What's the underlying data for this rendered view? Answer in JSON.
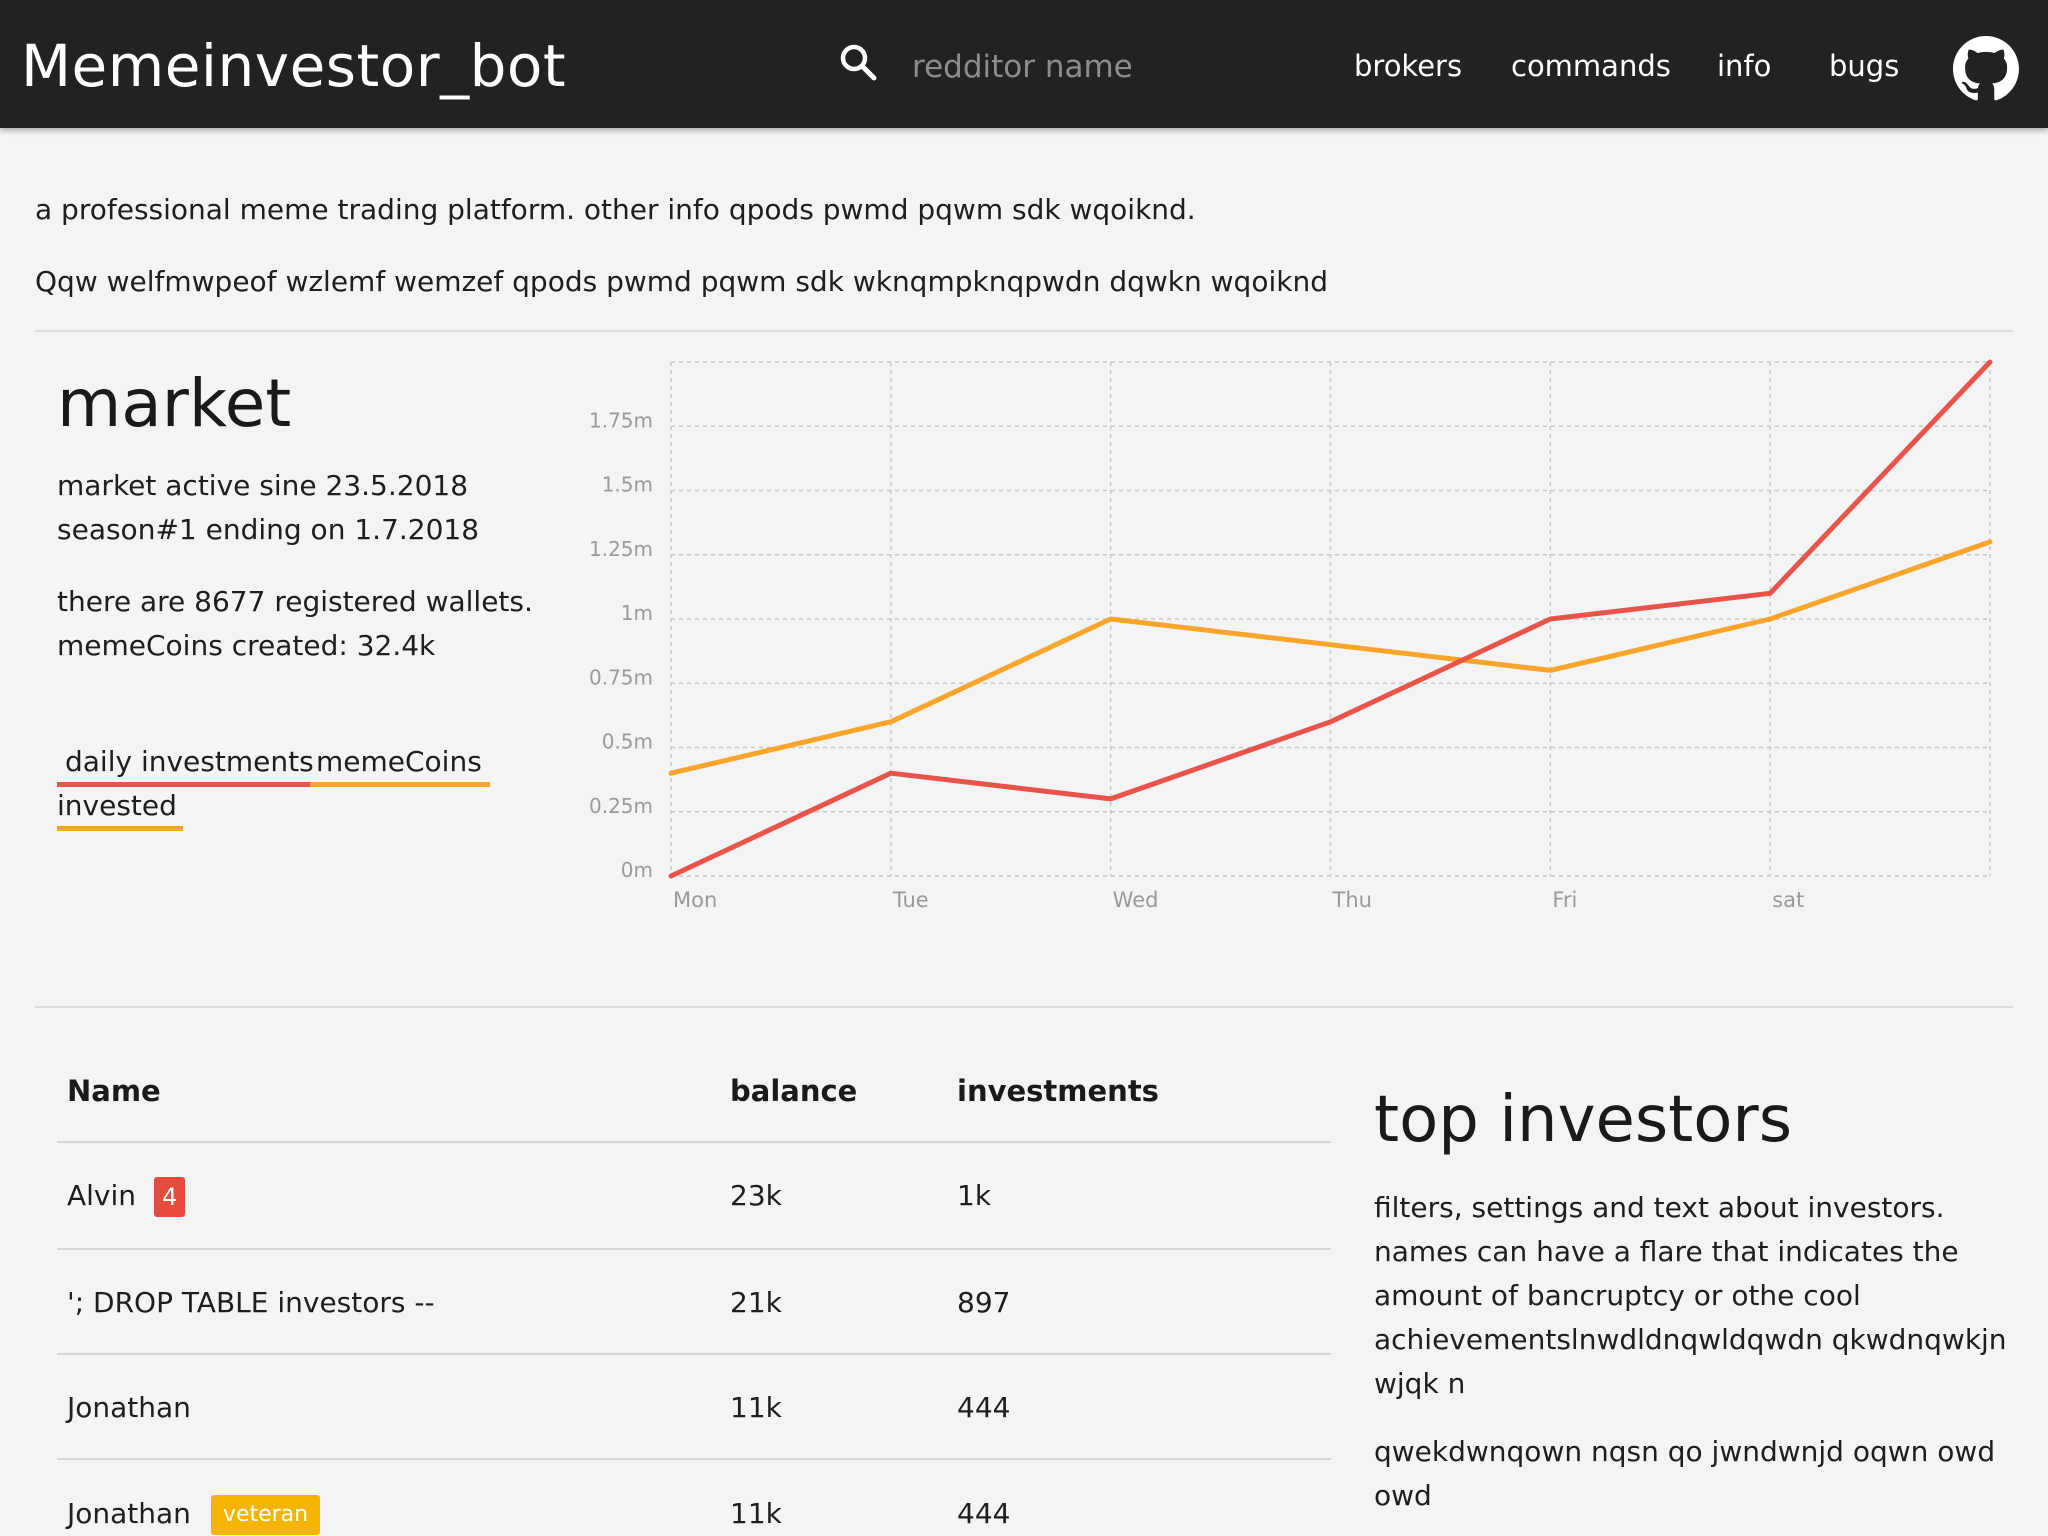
{
  "header": {
    "brand": "Memeinvestor_bot",
    "search_placeholder": "redditor name",
    "nav": [
      "brokers",
      "commands",
      "info",
      "bugs"
    ],
    "icons": [
      "search-icon",
      "github-icon"
    ]
  },
  "intro": {
    "line1": "a professional meme trading platform. other info qpods pwmd pqwm sdk wqoiknd.",
    "line2": "Qqw welfmwpeof wzlemf wemzef qpods pwmd pqwm sdk wknqmpknqpwdn dqwkn wqoiknd"
  },
  "market": {
    "title": "market",
    "active_since": "market active sine 23.5.2018",
    "season": "season#1 ending on 1.7.2018",
    "wallets": "there are 8677 registered wallets.",
    "coins_created": "memeCoins created: 32.4k",
    "legend": [
      "daily investments",
      "memeCoins invested"
    ]
  },
  "chart_data": {
    "type": "line",
    "x": [
      "Mon",
      "Tue",
      "Wed",
      "Thu",
      "Fri",
      "sat",
      ""
    ],
    "y_tick_labels": [
      "0m",
      "0.25m",
      "0.5m",
      "0.75m",
      "1m",
      "1.25m",
      "1.5m",
      "1.75m"
    ],
    "ylim": [
      0,
      2.0
    ],
    "grid": true,
    "series": [
      {
        "name": "daily investments",
        "color": "#e8534a",
        "values": [
          0,
          0.4,
          0.3,
          0.6,
          1.0,
          1.1,
          2.0
        ]
      },
      {
        "name": "memeCoins invested",
        "color": "#f9a52b",
        "values": [
          0.4,
          0.6,
          1.0,
          0.9,
          0.8,
          1.0,
          1.3
        ]
      }
    ]
  },
  "table": {
    "headers": [
      "Name",
      "balance",
      "investments"
    ],
    "rows": [
      {
        "name": "Alvin",
        "badge": "4",
        "balance": "23k",
        "investments": "1k"
      },
      {
        "name": "'; DROP TABLE investors --",
        "badge": "",
        "balance": "21k",
        "investments": "897"
      },
      {
        "name": "Jonathan",
        "badge": "",
        "balance": "11k",
        "investments": "444"
      },
      {
        "name": "Jonathan",
        "badge": "veteran",
        "balance": "11k",
        "investments": "444"
      }
    ]
  },
  "top_investors": {
    "title": "top investors",
    "para1": "filters, settings and text about investors. names can have a flare that indicates the amount of bancruptcy or othe cool achievementslnwdldnqwldqwdn qkwdnqwkjn wjqk n",
    "para2": "qwekdwnqown nqsn qo jwndwnjd oqwn owd owd"
  }
}
